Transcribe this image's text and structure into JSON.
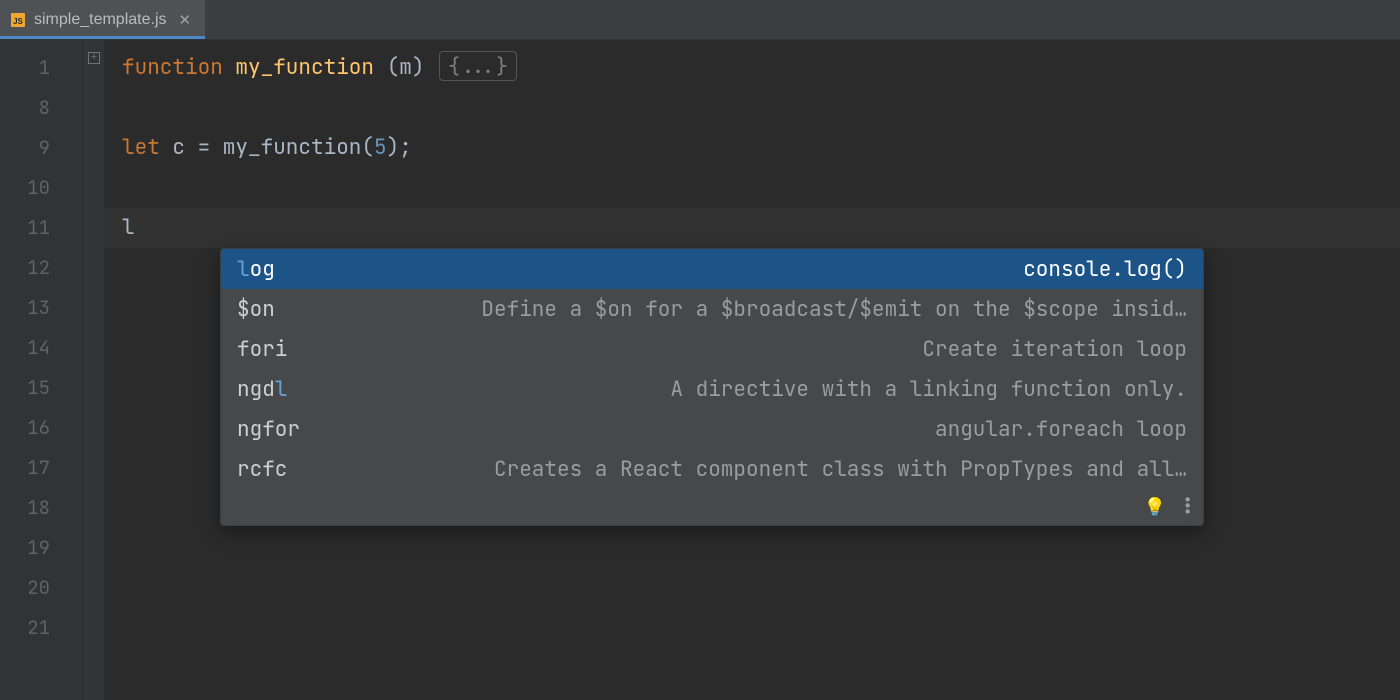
{
  "tab": {
    "filename": "simple_template.js"
  },
  "gutter_lines": [
    "1",
    "8",
    "9",
    "10",
    "11",
    "12",
    "13",
    "14",
    "15",
    "16",
    "17",
    "18",
    "19",
    "20",
    "21"
  ],
  "code": {
    "l1_kw": "function",
    "l1_fn": " my_function ",
    "l1_args": "(m) ",
    "l1_fold": "{...}",
    "l9_kw": "let",
    "l9_mid": " c = my_function(",
    "l9_num": "5",
    "l9_end": ");",
    "l11_text": "l"
  },
  "completion": {
    "items": [
      {
        "name_hl": "l",
        "name_rest": "og",
        "desc": "console.log()",
        "selected": true
      },
      {
        "name_hl": "",
        "name_rest": "$on",
        "desc": "Define a $on for a $broadcast/$emit on the $scope insid…"
      },
      {
        "name_hl": "",
        "name_rest": "fori",
        "desc": "Create iteration loop"
      },
      {
        "name_hl": "",
        "name_rest": "ngd",
        "name_rest2": "l",
        "desc": "A directive with a linking function only."
      },
      {
        "name_hl": "",
        "name_rest": "ngfor",
        "desc": "angular.foreach loop"
      },
      {
        "name_hl": "",
        "name_rest": "rcfc",
        "desc": "Creates a React component class with PropTypes and all…"
      }
    ]
  }
}
